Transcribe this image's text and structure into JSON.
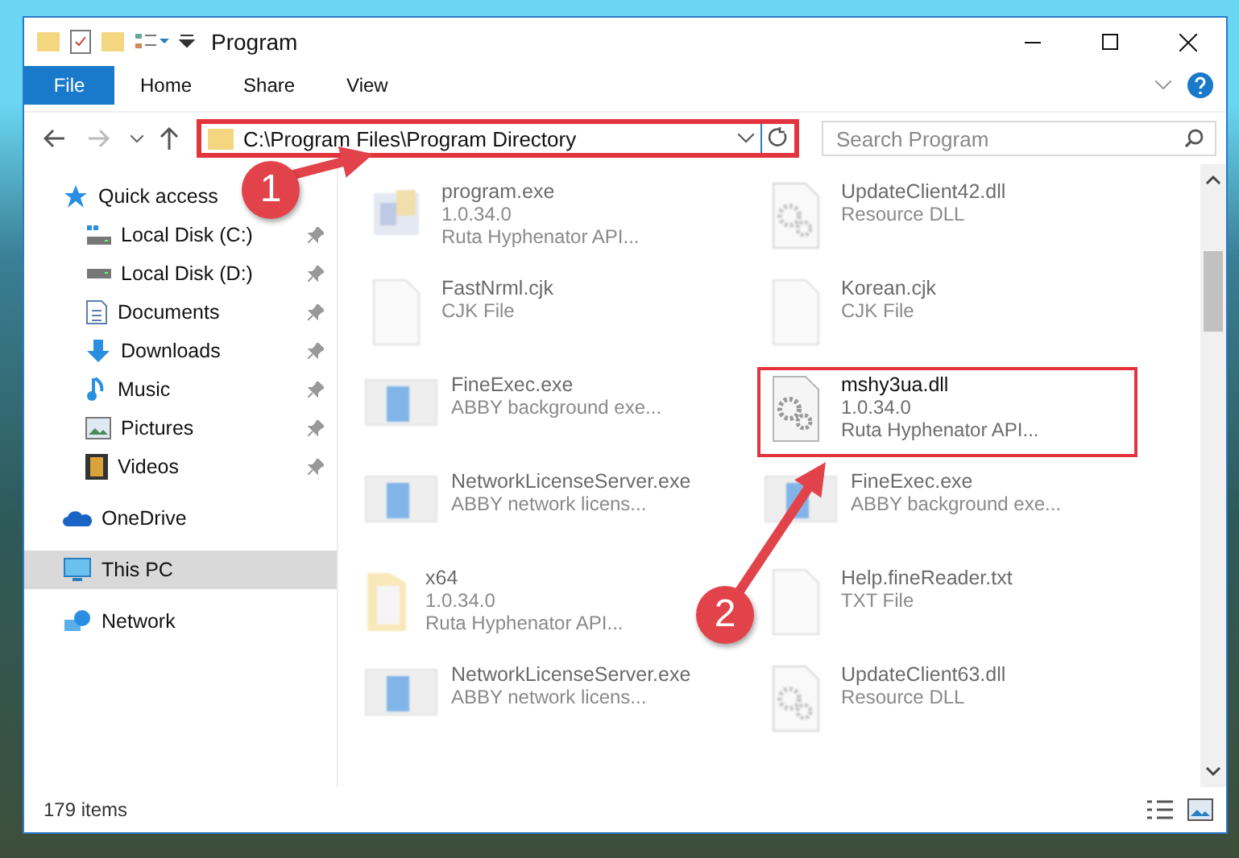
{
  "window": {
    "title": "Program"
  },
  "ribbon_tabs": [
    {
      "label": "File",
      "selected": true
    },
    {
      "label": "Home",
      "selected": false
    },
    {
      "label": "Share",
      "selected": false
    },
    {
      "label": "View",
      "selected": false
    }
  ],
  "address": {
    "path": "C:\\Program Files\\Program Directory",
    "highlighted": true
  },
  "search": {
    "placeholder": "Search Program"
  },
  "sidebar": {
    "items": [
      {
        "label": "Quick access",
        "kind": "star",
        "selected": false,
        "children": [
          {
            "label": "Local Disk (C:)",
            "kind": "drive-c",
            "selected": false,
            "pinned": true
          },
          {
            "label": "Local Disk (D:)",
            "kind": "drive",
            "selected": false,
            "pinned": true
          },
          {
            "label": "Documents",
            "kind": "documents",
            "selected": false,
            "pinned": true
          },
          {
            "label": "Downloads",
            "kind": "downloads",
            "selected": false,
            "pinned": true
          },
          {
            "label": "Music",
            "kind": "music",
            "selected": false,
            "pinned": true
          },
          {
            "label": "Pictures",
            "kind": "pictures",
            "selected": false,
            "pinned": true
          },
          {
            "label": "Videos",
            "kind": "videos",
            "selected": false,
            "pinned": true
          }
        ]
      },
      {
        "label": "OneDrive",
        "kind": "cloud",
        "selected": false
      },
      {
        "label": "This PC",
        "kind": "pc",
        "selected": true
      },
      {
        "label": "Network",
        "kind": "network",
        "selected": false
      }
    ]
  },
  "files": [
    {
      "name": "program.exe",
      "lines": [
        "1.0.34.0",
        "Ruta Hyphenator API..."
      ],
      "kind": "app",
      "blurred": true,
      "highlighted": false
    },
    {
      "name": "UpdateClient42.dll",
      "lines": [
        "Resource DLL"
      ],
      "kind": "dll",
      "blurred": true,
      "highlighted": false
    },
    {
      "name": "FastNrml.cjk",
      "lines": [
        "CJK File"
      ],
      "kind": "blank",
      "blurred": true,
      "highlighted": false
    },
    {
      "name": "Korean.cjk",
      "lines": [
        "CJK File"
      ],
      "kind": "blank",
      "blurred": true,
      "highlighted": false
    },
    {
      "name": "FineExec.exe",
      "lines": [
        "ABBY background exe..."
      ],
      "kind": "window",
      "blurred": true,
      "highlighted": false
    },
    {
      "name": "mshy3ua.dll",
      "lines": [
        "1.0.34.0",
        "Ruta Hyphenator API..."
      ],
      "kind": "dll",
      "blurred": false,
      "highlighted": true
    },
    {
      "name": "NetworkLicenseServer.exe",
      "lines": [
        "ABBY network licens..."
      ],
      "kind": "window",
      "blurred": true,
      "highlighted": false
    },
    {
      "name": "FineExec.exe",
      "lines": [
        "ABBY background exe..."
      ],
      "kind": "window",
      "blurred": true,
      "highlighted": false
    },
    {
      "name": "x64",
      "lines": [
        "1.0.34.0",
        "Ruta Hyphenator API..."
      ],
      "kind": "folder",
      "blurred": true,
      "highlighted": false
    },
    {
      "name": "Help.fineReader.txt",
      "lines": [
        "TXT File"
      ],
      "kind": "blank",
      "blurred": true,
      "highlighted": false
    },
    {
      "name": "NetworkLicenseServer.exe",
      "lines": [
        "ABBY network licens..."
      ],
      "kind": "window",
      "blurred": true,
      "highlighted": false
    },
    {
      "name": "UpdateClient63.dll",
      "lines": [
        "Resource DLL"
      ],
      "kind": "dll",
      "blurred": true,
      "highlighted": false
    }
  ],
  "status_bar": {
    "count": "179 items"
  },
  "callouts": [
    {
      "number": "1"
    },
    {
      "number": "2"
    }
  ]
}
